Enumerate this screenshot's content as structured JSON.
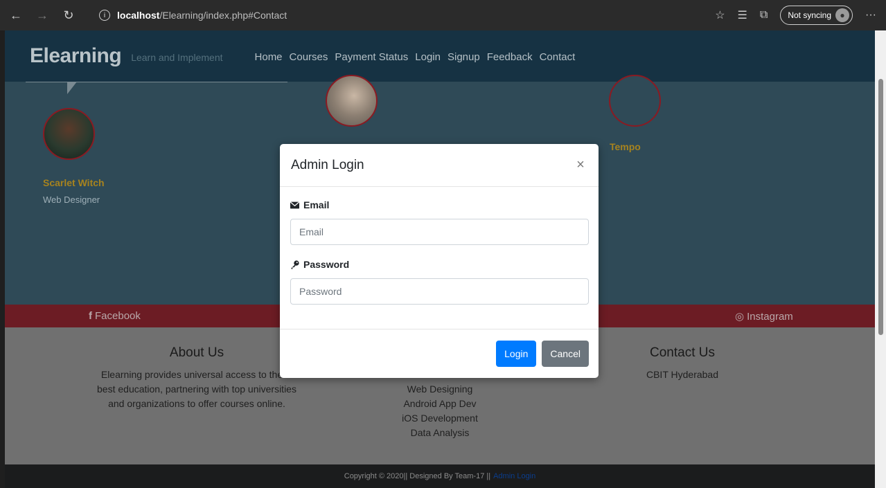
{
  "browser": {
    "back_icon": "←",
    "forward_icon": "→",
    "refresh_icon": "↻",
    "url_host": "localhost",
    "url_path": "/Elearning/index.php#Contact",
    "sync_label": "Not syncing",
    "more_icon": "···"
  },
  "site": {
    "brand": "Elearning",
    "tagline": "Learn and Implement",
    "nav": [
      "Home",
      "Courses",
      "Payment Status",
      "Login",
      "Signup",
      "Feedback",
      "Contact"
    ]
  },
  "team": {
    "member1_name": "Scarlet Witch",
    "member1_role": "Web Designer",
    "member3_name": "Tempo"
  },
  "social": {
    "facebook": "Facebook",
    "instagram": "Instagram"
  },
  "footer": {
    "about_title": "About Us",
    "about_lines": [
      "Elearning provides universal access to the w",
      "best education, partnering with top universities",
      "and organizations to offer courses online."
    ],
    "courses_list": [
      "Web Designing",
      "Android App Dev",
      "iOS Development",
      "Data Analysis"
    ],
    "contact_title": "Contact Us",
    "contact_text": "CBIT Hyderabad",
    "copyright": "Copyright © 2020|| Designed By Team-17 ||",
    "admin_link": "Admin Login"
  },
  "modal": {
    "title": "Admin Login",
    "close": "×",
    "email_label": "Email",
    "email_placeholder": "Email",
    "email_value": "",
    "password_label": "Password",
    "password_placeholder": "Password",
    "password_value": "",
    "login_button": "Login",
    "cancel_button": "Cancel"
  },
  "colors": {
    "primary": "#007bff",
    "secondary": "#6c757d",
    "navbar": "#163243",
    "accent_red": "#8a1a22",
    "gold": "#a7831e"
  }
}
